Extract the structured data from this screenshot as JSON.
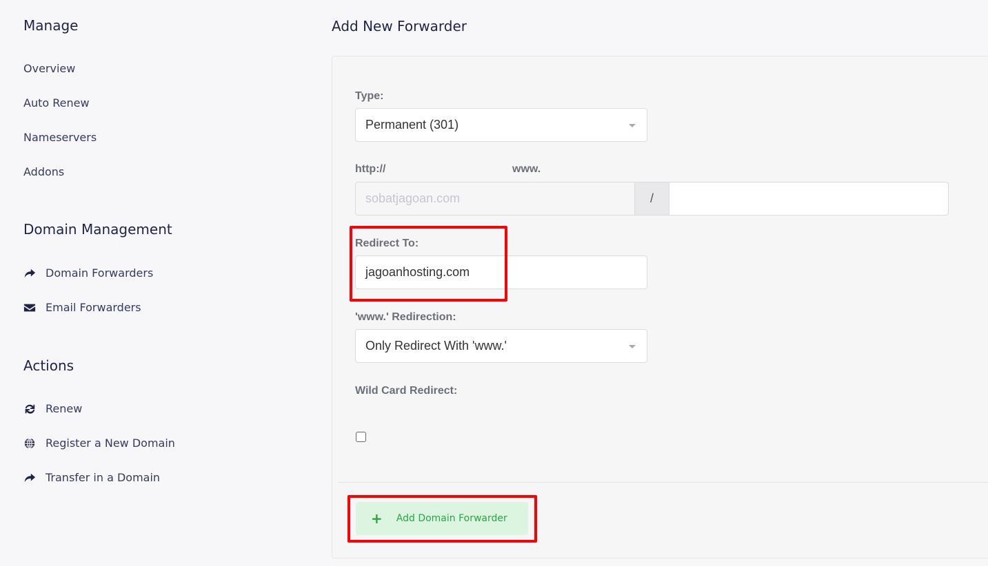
{
  "sidebar": {
    "manage": {
      "heading": "Manage",
      "items": [
        "Overview",
        "Auto Renew",
        "Nameservers",
        "Addons"
      ]
    },
    "domain_management": {
      "heading": "Domain Management",
      "items": [
        {
          "label": "Domain Forwarders",
          "icon": "share-icon"
        },
        {
          "label": "Email Forwarders",
          "icon": "envelope-icon"
        }
      ]
    },
    "actions": {
      "heading": "Actions",
      "items": [
        {
          "label": "Renew",
          "icon": "refresh-icon"
        },
        {
          "label": "Register a New Domain",
          "icon": "globe-icon"
        },
        {
          "label": "Transfer in a Domain",
          "icon": "share-icon"
        }
      ]
    }
  },
  "form": {
    "title": "Add New Forwarder",
    "type_label": "Type:",
    "type_value": "Permanent (301)",
    "http_label": "http://",
    "www_label": "www.",
    "domain_value": "sobatjagoan.com",
    "slash": "/",
    "path_value": "",
    "redirect_label": "Redirect To:",
    "redirect_value": "jagoanhosting.com",
    "www_redirect_label": "'www.' Redirection:",
    "www_redirect_value": "Only Redirect With 'www.'",
    "wildcard_label": "Wild Card Redirect:",
    "wildcard_checked": false,
    "submit_label": "Add Domain Forwarder"
  },
  "colors": {
    "accent_green": "#28a745",
    "button_bg": "#dcf5e0",
    "highlight": "#ff0000"
  }
}
